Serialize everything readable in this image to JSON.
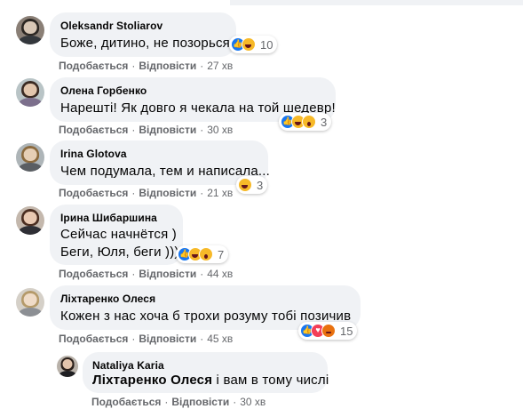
{
  "comments": [
    {
      "name": "Oleksandr Stoliarov",
      "text": [
        "Боже, дитино, не позорься"
      ],
      "reactions": {
        "icons": [
          "like-icon",
          "haha-icon"
        ],
        "count": "10"
      },
      "actions": {
        "like": "Подобається",
        "reply": "Відповісти",
        "time": "27 хв"
      }
    },
    {
      "name": "Олена Горбенко",
      "text": [
        "Нарешті! Як довго я чекала на той шедевр!"
      ],
      "reactions": {
        "icons": [
          "like-icon",
          "haha-icon",
          "wow-icon"
        ],
        "count": "3"
      },
      "actions": {
        "like": "Подобається",
        "reply": "Відповісти",
        "time": "30 хв"
      }
    },
    {
      "name": "Irina Glotova",
      "text": [
        "Чем подумала, тем и написала..."
      ],
      "reactions": {
        "icons": [
          "haha-icon"
        ],
        "count": "3"
      },
      "actions": {
        "like": "Подобається",
        "reply": "Відповісти",
        "time": "21 хв"
      }
    },
    {
      "name": "Ірина Шибаршина",
      "text": [
        "Сейчас начнётся )",
        "Беги, Юля, беги )))"
      ],
      "reactions": {
        "icons": [
          "like-icon",
          "haha-icon",
          "wow-icon"
        ],
        "count": "7"
      },
      "actions": {
        "like": "Подобається",
        "reply": "Відповісти",
        "time": "44 хв"
      }
    },
    {
      "name": "Ліхтаренко Олеся",
      "text": [
        "Кожен з нас хоча б трохи розуму тобі позичив"
      ],
      "reactions": {
        "icons": [
          "like-icon",
          "love-icon",
          "angry-icon"
        ],
        "count": "15"
      },
      "actions": {
        "like": "Подобається",
        "reply": "Відповісти",
        "time": "45 хв"
      }
    }
  ],
  "reply": {
    "name": "Nataliya Karia",
    "mention": "Ліхтаренко Олеся",
    "text": " і вам в тому числі",
    "actions": {
      "like": "Подобається",
      "reply": "Відповісти",
      "time": "30 хв"
    }
  },
  "colors": {
    "bubble": "#f0f2f5",
    "secondary_text": "#65676b",
    "like": "#1877f2",
    "haha": "#f7b928",
    "love": "#f33e58"
  }
}
